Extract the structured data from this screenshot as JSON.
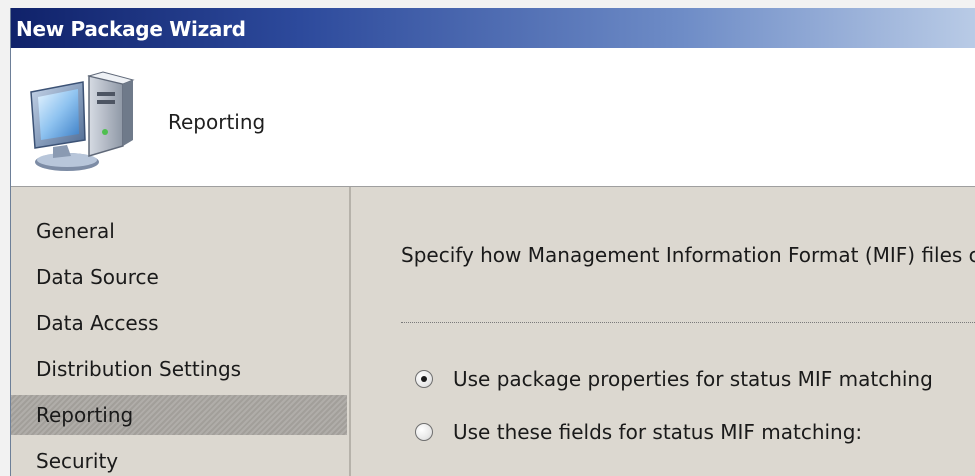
{
  "window": {
    "title": "New Package Wizard"
  },
  "header": {
    "icon": "computer-icon",
    "page_title": "Reporting"
  },
  "sidebar": {
    "items": [
      {
        "label": "General"
      },
      {
        "label": "Data Source"
      },
      {
        "label": "Data Access"
      },
      {
        "label": "Distribution Settings"
      },
      {
        "label": "Reporting",
        "selected": true
      },
      {
        "label": "Security"
      }
    ]
  },
  "main": {
    "description": "Specify how Management Information Format (MIF) files c",
    "options": [
      {
        "label": "Use package properties for status MIF matching",
        "selected": true
      },
      {
        "label": "Use these fields for status MIF matching:",
        "selected": false
      }
    ]
  },
  "colors": {
    "titlebar_start": "#10226a",
    "titlebar_end": "#b9cbe6",
    "panel_bg": "#dcd8d0",
    "selected_item_bg": "#a7a49f"
  }
}
